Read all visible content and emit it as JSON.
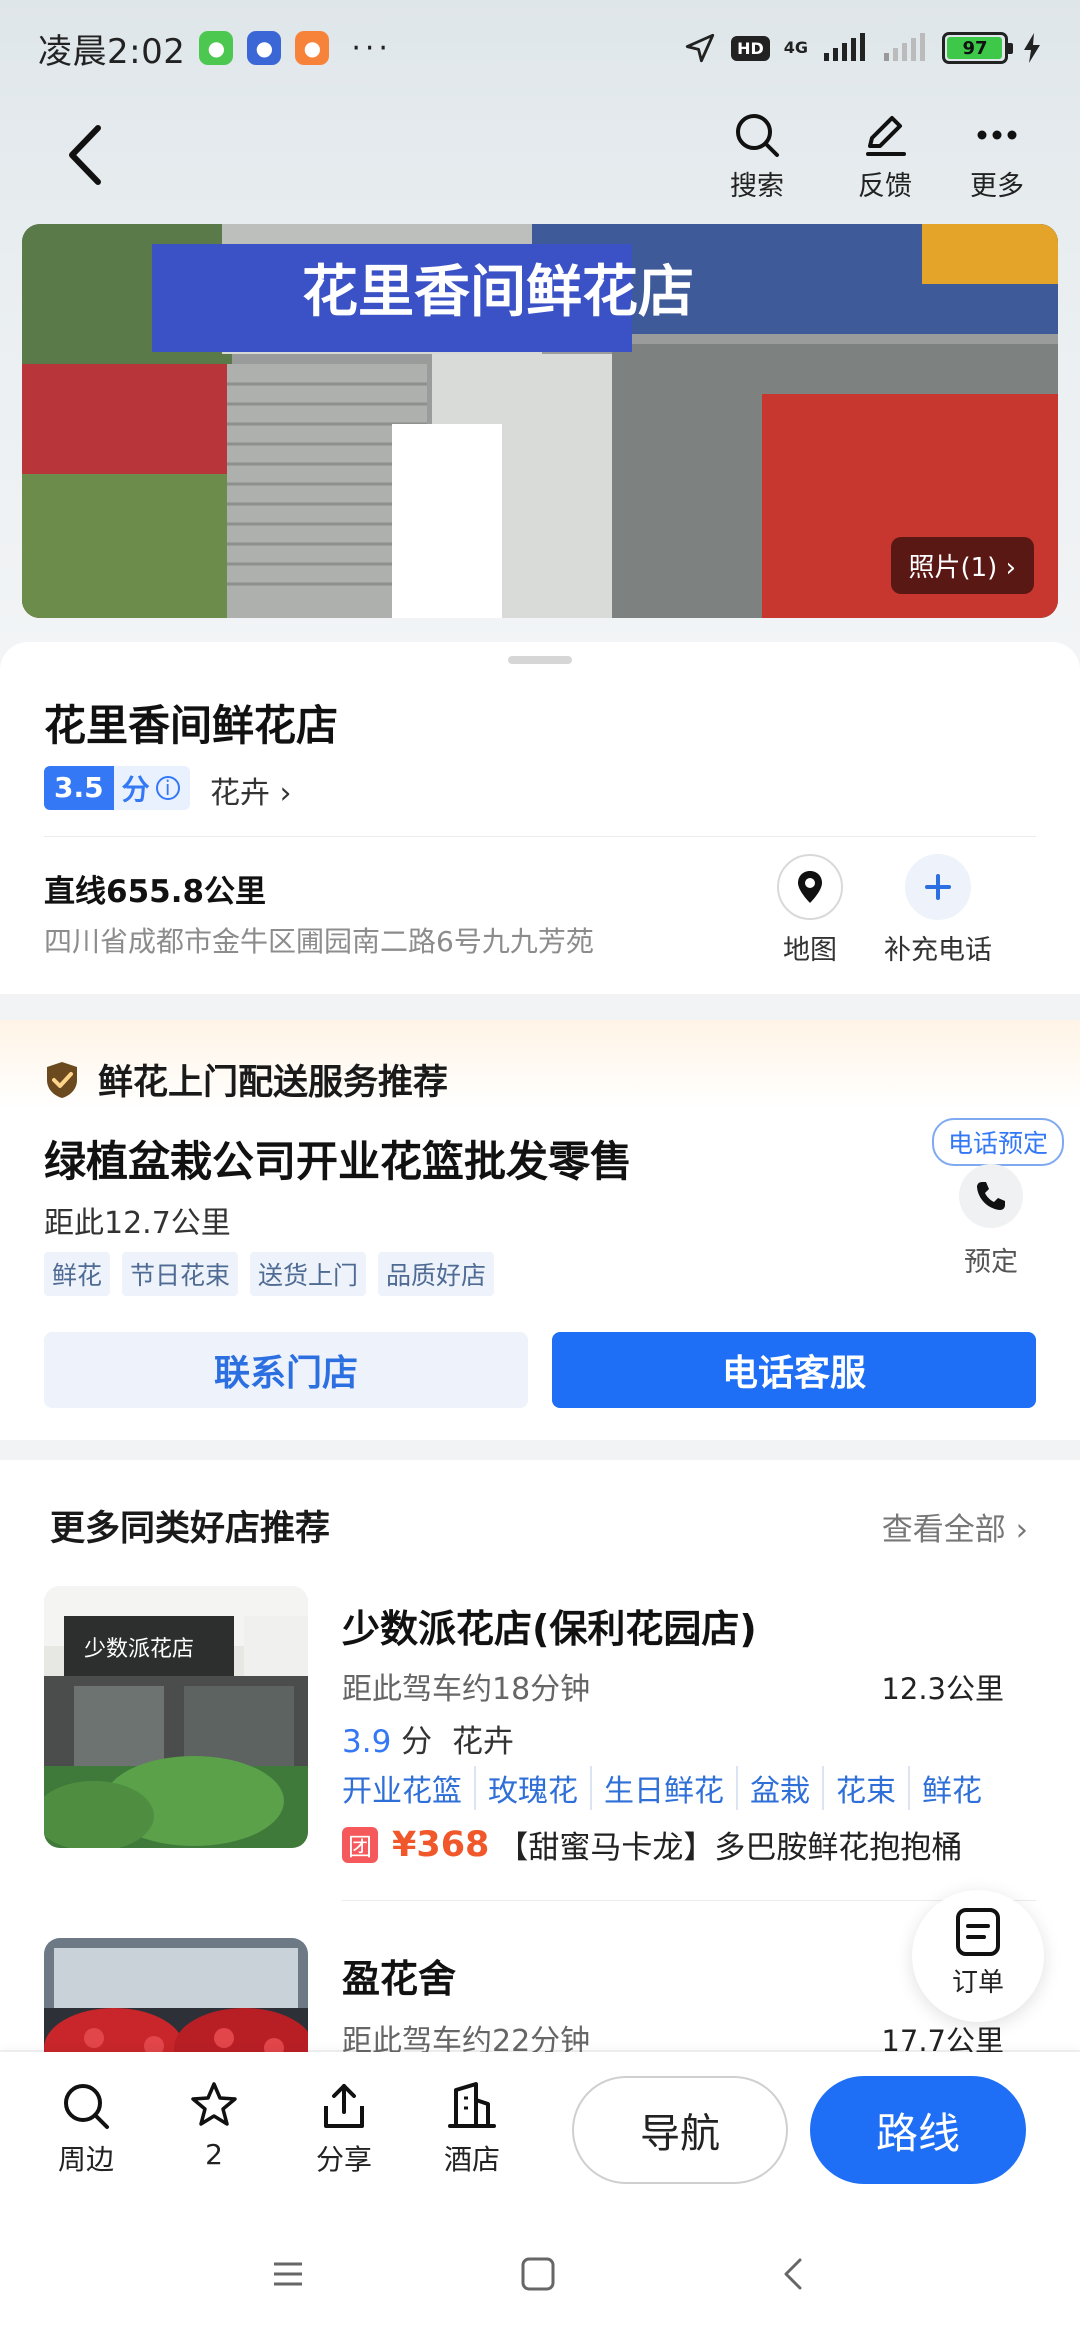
{
  "status_bar": {
    "time": "凌晨2:02",
    "more": "···",
    "hd": "HD",
    "network": "4G",
    "battery": "97"
  },
  "nav": {
    "search_label": "搜索",
    "feedback_label": "反馈",
    "more_label": "更多"
  },
  "photo": {
    "sign_text": "花里香间鲜花店",
    "badge": "照片(1) ›"
  },
  "shop": {
    "name": "花里香间鲜花店",
    "score": "3.5",
    "score_unit": "分",
    "category": "花卉 ›",
    "distance": "直线655.8公里",
    "address": "四川省成都市金牛区圃园南二路6号九九芳苑",
    "map_label": "地图",
    "add_phone_label": "补充电话"
  },
  "delivery": {
    "heading": "鲜花上门配送服务推荐",
    "title": "绿植盆栽公司开业花篮批发零售",
    "distance": "距此12.7公里",
    "tags": [
      "鲜花",
      "节日花束",
      "送货上门",
      "品质好店"
    ],
    "phone_badge": "电话预定",
    "reserve_label": "预定",
    "contact_button": "联系门店",
    "phone_button": "电话客服"
  },
  "recommend": {
    "heading": "更多同类好店推荐",
    "view_all": "查看全部 ›",
    "items": [
      {
        "name": "少数派花店(保利花园店)",
        "drive": "距此驾车约18分钟",
        "km": "12.3公里",
        "score": "3.9",
        "score_unit": "分",
        "category": "花卉",
        "tags": [
          "开业花篮",
          "玫瑰花",
          "生日鲜花",
          "盆栽",
          "花束",
          "鲜花"
        ],
        "deal_badge": "团",
        "price": "¥368",
        "deal_text": "【甜蜜马卡龙】多巴胺鲜花抱抱桶",
        "img_sign": "少数派花店"
      },
      {
        "name": "盈花舍",
        "drive": "距此驾车约22分钟",
        "km": "17.7公里"
      }
    ]
  },
  "order_fab": {
    "label": "订单"
  },
  "bottom_bar": {
    "nearby": "周边",
    "favorites": "2",
    "share": "分享",
    "hotel": "酒店",
    "navigate": "导航",
    "route": "路线"
  },
  "colors": {
    "accent": "#1e6ff5",
    "price": "#f0572b",
    "rating_bg": "#3478f6"
  }
}
